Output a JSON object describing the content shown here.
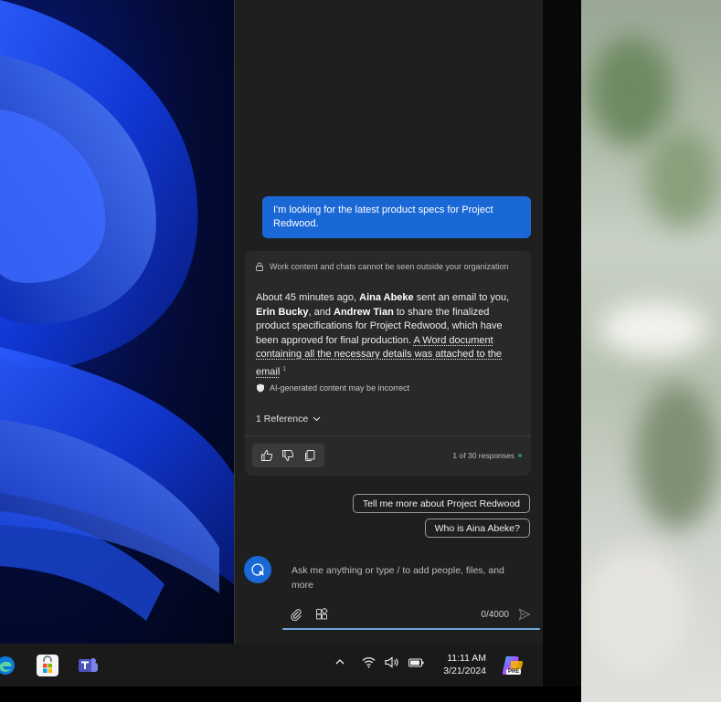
{
  "chat": {
    "user_message": "I'm looking for the latest product specs for Project Redwood.",
    "privacy_notice": "Work content and chats cannot be seen outside your organization",
    "answer": {
      "part1": "About 45 minutes ago, ",
      "person1": "Aina Abeke",
      "part2": " sent an email to you, ",
      "person2": "Erin Bucky",
      "part3": ", and ",
      "person3": "Andrew Tian",
      "part4": " to share the finalized product specifications for Project Redwood, which have been approved for final production. ",
      "link_text": "A Word document containing all the necessary details was attached to the email",
      "citation": "1"
    },
    "ai_disclaimer": "AI-generated content may be incorrect",
    "references_label": "1 Reference",
    "responses_counter": "1 of 30 responses",
    "suggestions": [
      "Tell me more about Project Redwood",
      "Who is Aina Abeke?"
    ],
    "compose": {
      "placeholder": "Ask me anything or type / to add people, files, and more",
      "char_count": "0/4000"
    }
  },
  "taskbar": {
    "time": "11:11 AM",
    "date": "3/21/2024",
    "pinned_apps": [
      "edge-icon",
      "store-icon",
      "teams-icon"
    ],
    "tray_icons": [
      "chevron-up-icon",
      "wifi-icon",
      "volume-icon",
      "battery-icon"
    ],
    "copilot_badge": "PRE"
  },
  "colors": {
    "accent": "#1a68d6",
    "panel_bg": "#1f1f1f",
    "card_bg": "#292929",
    "taskbar_bg": "#1a1a1a"
  }
}
